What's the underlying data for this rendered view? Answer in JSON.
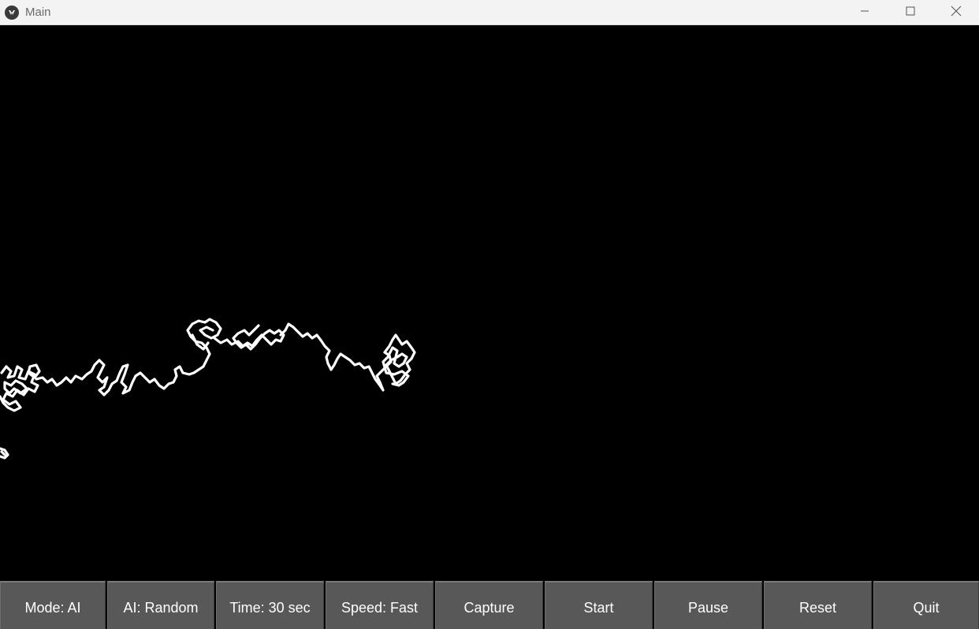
{
  "window": {
    "title": "Main",
    "controls": [
      "minimize-icon",
      "maximize-icon",
      "close-icon"
    ]
  },
  "canvas": {
    "background": "#000000",
    "stroke_color": "#ffffff"
  },
  "toolbar": {
    "buttons": [
      {
        "label": "Mode: AI"
      },
      {
        "label": "AI: Random"
      },
      {
        "label": "Time: 30 sec"
      },
      {
        "label": "Speed: Fast"
      },
      {
        "label": "Capture"
      },
      {
        "label": "Start"
      },
      {
        "label": "Pause"
      },
      {
        "label": "Reset"
      },
      {
        "label": "Quit"
      }
    ]
  },
  "colors": {
    "titlebar": "#f3f3f3",
    "button_face": "#585858",
    "button_text": "#ffffff"
  }
}
